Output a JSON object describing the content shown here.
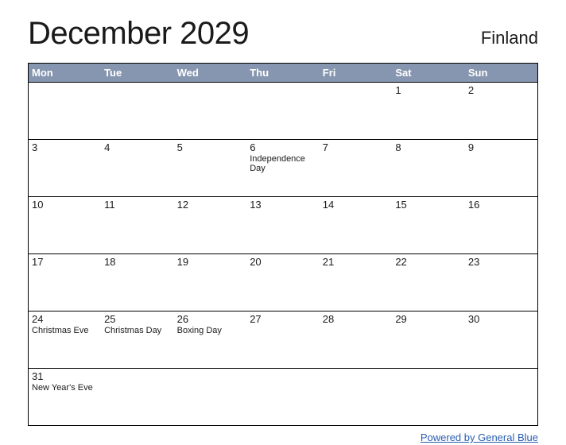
{
  "title": "December 2029",
  "country": "Finland",
  "weekdays": [
    "Mon",
    "Tue",
    "Wed",
    "Thu",
    "Fri",
    "Sat",
    "Sun"
  ],
  "weeks": [
    [
      {
        "day": "",
        "event": ""
      },
      {
        "day": "",
        "event": ""
      },
      {
        "day": "",
        "event": ""
      },
      {
        "day": "",
        "event": ""
      },
      {
        "day": "",
        "event": ""
      },
      {
        "day": "1",
        "event": ""
      },
      {
        "day": "2",
        "event": ""
      }
    ],
    [
      {
        "day": "3",
        "event": ""
      },
      {
        "day": "4",
        "event": ""
      },
      {
        "day": "5",
        "event": ""
      },
      {
        "day": "6",
        "event": "Independence Day"
      },
      {
        "day": "7",
        "event": ""
      },
      {
        "day": "8",
        "event": ""
      },
      {
        "day": "9",
        "event": ""
      }
    ],
    [
      {
        "day": "10",
        "event": ""
      },
      {
        "day": "11",
        "event": ""
      },
      {
        "day": "12",
        "event": ""
      },
      {
        "day": "13",
        "event": ""
      },
      {
        "day": "14",
        "event": ""
      },
      {
        "day": "15",
        "event": ""
      },
      {
        "day": "16",
        "event": ""
      }
    ],
    [
      {
        "day": "17",
        "event": ""
      },
      {
        "day": "18",
        "event": ""
      },
      {
        "day": "19",
        "event": ""
      },
      {
        "day": "20",
        "event": ""
      },
      {
        "day": "21",
        "event": ""
      },
      {
        "day": "22",
        "event": ""
      },
      {
        "day": "23",
        "event": ""
      }
    ],
    [
      {
        "day": "24",
        "event": "Christmas Eve"
      },
      {
        "day": "25",
        "event": "Christmas Day"
      },
      {
        "day": "26",
        "event": "Boxing Day"
      },
      {
        "day": "27",
        "event": ""
      },
      {
        "day": "28",
        "event": ""
      },
      {
        "day": "29",
        "event": ""
      },
      {
        "day": "30",
        "event": ""
      }
    ],
    [
      {
        "day": "31",
        "event": "New Year's Eve"
      },
      {
        "day": "",
        "event": ""
      },
      {
        "day": "",
        "event": ""
      },
      {
        "day": "",
        "event": ""
      },
      {
        "day": "",
        "event": ""
      },
      {
        "day": "",
        "event": ""
      },
      {
        "day": "",
        "event": ""
      }
    ]
  ],
  "footer_link": "Powered by General Blue"
}
